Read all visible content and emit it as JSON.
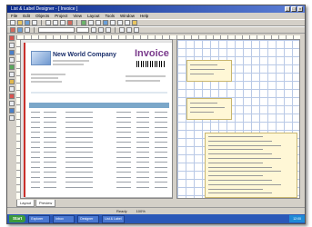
{
  "window": {
    "title": "List & Label Designer - [ Invoice ]"
  },
  "menu": [
    "File",
    "Edit",
    "Objects",
    "Project",
    "View",
    "Layout",
    "Tools",
    "Window",
    "Help"
  ],
  "document": {
    "company": "New World Company",
    "doc_title": "Invoice"
  },
  "tabs": [
    "Layout",
    "Preview"
  ],
  "status": [
    "Ready",
    "100%"
  ],
  "taskbar": {
    "start": "Start",
    "tasks": [
      "Explorer",
      "Inbox",
      "Designer",
      "List & Label"
    ],
    "clock": "12:00"
  }
}
